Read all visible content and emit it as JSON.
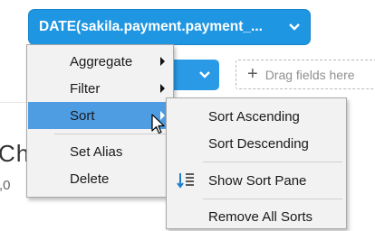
{
  "field_pill": {
    "label": "DATE(sakila.payment.payment_...",
    "icon": "chevron-down-icon"
  },
  "drop_zone": {
    "label": "Drag fields here",
    "icon": "plus-icon"
  },
  "background_fragments": {
    "ch": "Ch",
    "zero": ",0"
  },
  "context_menu": {
    "items": [
      {
        "label": "Aggregate",
        "has_submenu": true
      },
      {
        "label": "Filter",
        "has_submenu": true
      },
      {
        "label": "Sort",
        "has_submenu": true,
        "active": true
      },
      {
        "label": "Set Alias",
        "has_submenu": false
      },
      {
        "label": "Delete",
        "has_submenu": false
      }
    ]
  },
  "sort_submenu": {
    "items": [
      {
        "label": "Sort Ascending"
      },
      {
        "label": "Sort Descending"
      },
      {
        "label": "Show Sort Pane",
        "icon": "sort-pane-icon"
      },
      {
        "label": "Remove All Sorts"
      }
    ]
  },
  "colors": {
    "accent": "#1e96e2",
    "menu_bg": "#f2f2f2",
    "highlight": "#4e9de3"
  }
}
